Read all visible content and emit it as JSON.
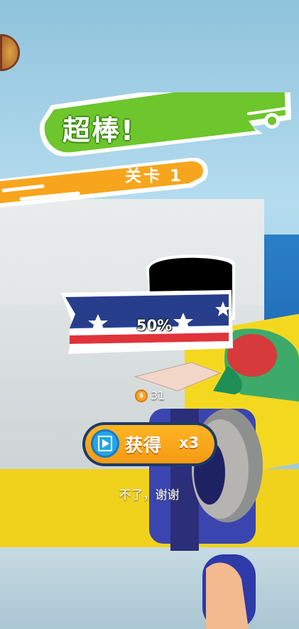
{
  "banner": {
    "title": "超棒!",
    "level": "关卡 1"
  },
  "progress": {
    "label": "50%",
    "value": 0.5
  },
  "coins": {
    "count": "31",
    "icon": "coin-icon"
  },
  "get_button": {
    "label": "获得",
    "multiplier": "x3",
    "icon": "video-play-icon"
  },
  "no_thanks": {
    "label": "不了，谢谢"
  },
  "colors": {
    "green": "#6cc62c",
    "orange": "#f7a51d",
    "flag_blue": "#263e8c",
    "flag_red": "#e0333a"
  }
}
